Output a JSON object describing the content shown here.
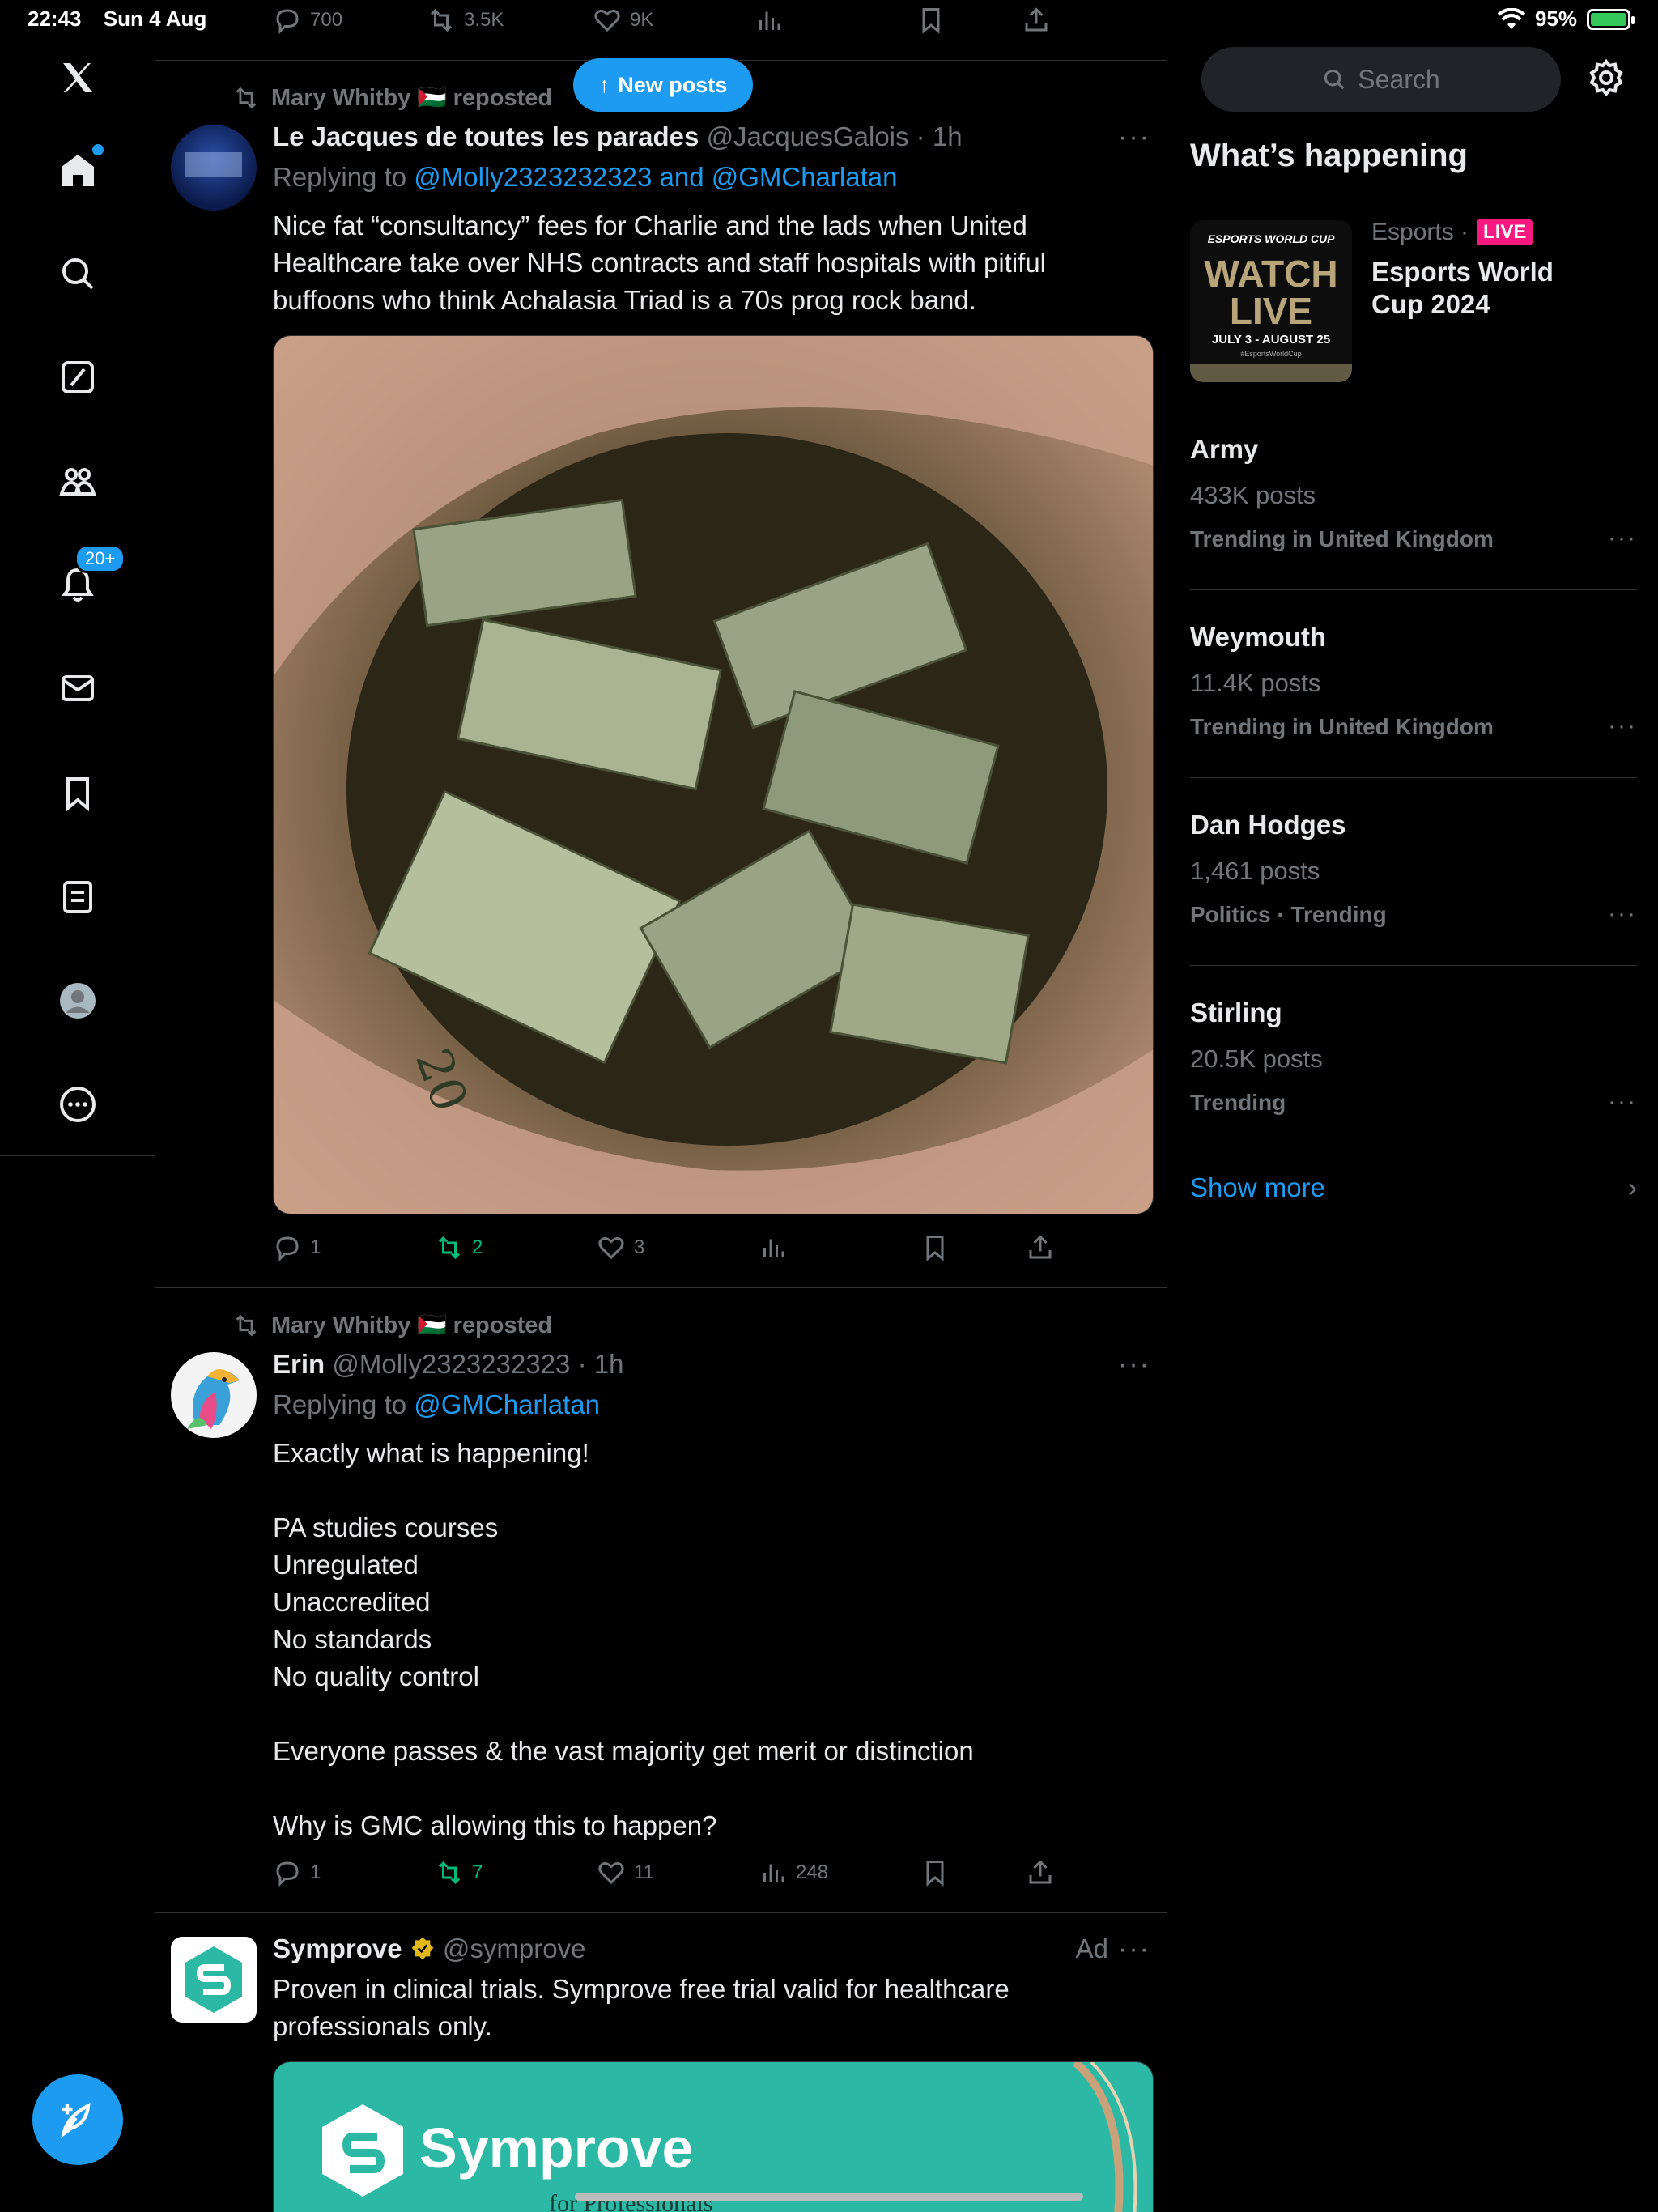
{
  "status_bar": {
    "time": "22:43",
    "date": "Sun 4 Aug",
    "battery": "95%"
  },
  "nav": {
    "notifications_badge": "20+"
  },
  "top_actions": {
    "replies": "700",
    "reposts": "3.5K",
    "likes": "9K"
  },
  "new_posts_label": "New posts",
  "posts": [
    {
      "repost_by": "Mary Whitby 🇵🇸 reposted",
      "name": "Le Jacques de toutes les parades",
      "handle": "@JacquesGalois · 1h",
      "replying_prefix": "Replying to",
      "replying_to": "@Molly2323232323 and @GMCharlatan",
      "text": "Nice fat “consultancy” fees for Charlie and the lads when United Healthcare take over NHS contracts and staff hospitals with pitiful buffoons who think Achalasia Triad is a 70s prog rock band.",
      "media_text": "20",
      "replies": "1",
      "reposts": "2",
      "likes": "3",
      "views": ""
    },
    {
      "repost_by": "Mary Whitby 🇵🇸 reposted",
      "name": "Erin",
      "handle": "@Molly2323232323 · 1h",
      "replying_prefix": "Replying to",
      "replying_to": "@GMCharlatan",
      "text_lines": [
        "Exactly what is happening!",
        "",
        "PA studies courses",
        "Unregulated",
        "Unaccredited",
        "No standards",
        "No quality control",
        "",
        "Everyone passes & the vast majority get merit or distinction",
        "",
        "Why is GMC allowing this to happen?"
      ],
      "replies": "1",
      "reposts": "7",
      "likes": "11",
      "views": "248"
    },
    {
      "name": "Symprove",
      "handle": "@symprove",
      "ad_label": "Ad",
      "text": "Proven in clinical trials. Symprove free trial valid for healthcare professionals only.",
      "media_brand": "Symprove",
      "media_sub": "for Professionals"
    }
  ],
  "sidebar": {
    "search_placeholder": "Search",
    "whats_happening": "What’s happening",
    "featured": {
      "category": "Esports ·",
      "live_label": "LIVE",
      "title": "Esports World Cup 2024",
      "card_top": "ESPORTS WORLD CUP",
      "card_main_1": "WATCH",
      "card_main_2": "LIVE",
      "card_dates": "JULY 3 - AUGUST 25",
      "card_tag": "#EsportsWorldCup"
    },
    "trends": [
      {
        "name": "Army",
        "count": "433K posts",
        "context": "Trending in United Kingdom"
      },
      {
        "name": "Weymouth",
        "count": "11.4K posts",
        "context": "Trending in United Kingdom"
      },
      {
        "name": "Dan Hodges",
        "count": "1,461 posts",
        "context": "Politics · Trending"
      },
      {
        "name": "Stirling",
        "count": "20.5K posts",
        "context": "Trending"
      }
    ],
    "show_more": "Show more"
  },
  "colors": {
    "accent": "#1d9bf0",
    "repost_green": "#00ba7c",
    "live_pink": "#f91880",
    "symprove_teal": "#2bb9a6"
  },
  "icons": [
    "x-logo-icon",
    "home-icon",
    "search-icon",
    "grok-icon",
    "communities-icon",
    "bell-icon",
    "mail-icon",
    "bookmark-icon",
    "lists-icon",
    "profile-icon",
    "more-icon",
    "compose-icon",
    "reply-icon",
    "repost-icon",
    "like-icon",
    "views-icon",
    "share-icon",
    "gear-icon",
    "verified-icon",
    "wifi-icon"
  ]
}
